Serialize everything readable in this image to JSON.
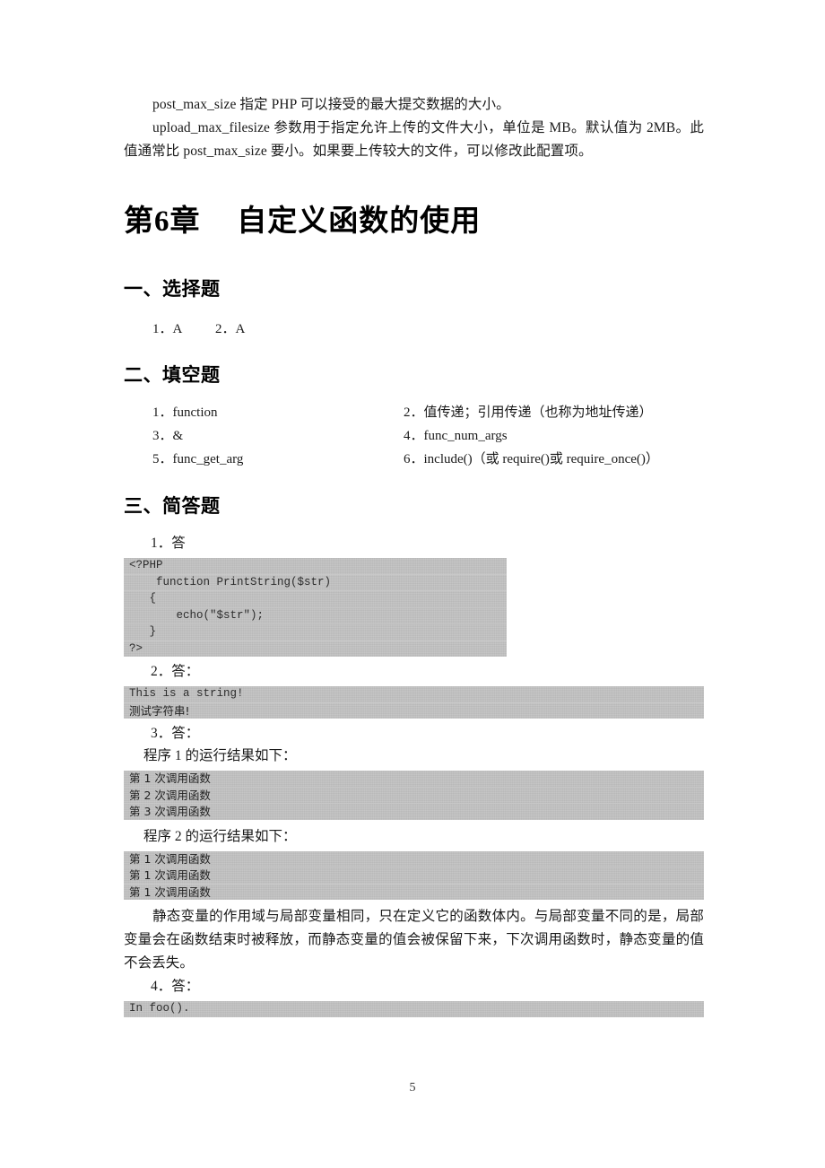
{
  "document": {
    "page_number": "5",
    "intro_paragraphs": [
      "post_max_size 指定 PHP 可以接受的最大提交数据的大小。",
      "upload_max_filesize 参数用于指定允许上传的文件大小，单位是 MB。默认值为 2MB。此值通常比 post_max_size 要小。如果要上传较大的文件，可以修改此配置项。"
    ],
    "chapter": {
      "prefix": "第",
      "number": "6",
      "suffix": "章",
      "title": "自定义函数的使用"
    },
    "sections": [
      {
        "heading": "一、选择题",
        "answers_inline": "1．A          2．A"
      },
      {
        "heading": "二、填空题",
        "fill_in_rows": [
          {
            "left": "1．function",
            "right": "2．值传递；引用传递（也称为地址传递）"
          },
          {
            "left": "3．&",
            "right": "4．func_num_args"
          },
          {
            "left": "5．func_get_arg",
            "right": "6．include()（或 require()或 require_once()）"
          }
        ]
      },
      {
        "heading": "三、简答题",
        "items": [
          {
            "label": "1．答",
            "code": {
              "width_class": "cb-w565",
              "lines": [
                {
                  "text": "<?PHP",
                  "cjk": false
                },
                {
                  "text": "    function PrintString($str)",
                  "cjk": false
                },
                {
                  "text": "   {",
                  "cjk": false
                },
                {
                  "text": "       echo(\"$str\");",
                  "cjk": false
                },
                {
                  "text": "   }",
                  "cjk": false
                },
                {
                  "text": "?>",
                  "cjk": false
                }
              ]
            }
          },
          {
            "label": "2．答：",
            "code": {
              "width_class": "cb-w785",
              "lines": [
                {
                  "text": "This is a string!",
                  "cjk": false
                },
                {
                  "text": "测试字符串!",
                  "cjk": true
                }
              ]
            }
          },
          {
            "label": "3．答：",
            "intro_1": "程序 1 的运行结果如下：",
            "code_1": {
              "width_class": "cb-w785",
              "lines": [
                {
                  "text": "第 1 次调用函数",
                  "cjk": true
                },
                {
                  "text": "第 2 次调用函数",
                  "cjk": true
                },
                {
                  "text": "第 3 次调用函数",
                  "cjk": true
                }
              ]
            },
            "intro_2": "程序 2 的运行结果如下：",
            "code_2": {
              "width_class": "cb-w785",
              "lines": [
                {
                  "text": "第 1 次调用函数",
                  "cjk": true
                },
                {
                  "text": "第 1 次调用函数",
                  "cjk": true
                },
                {
                  "text": "第 1 次调用函数",
                  "cjk": true
                }
              ]
            },
            "explanation": "静态变量的作用域与局部变量相同，只在定义它的函数体内。与局部变量不同的是，局部变量会在函数结束时被释放，而静态变量的值会被保留下来，下次调用函数时，静态变量的值不会丢失。"
          },
          {
            "label": "4．答：",
            "code": {
              "width_class": "cb-w785",
              "lines": [
                {
                  "text": "In foo().",
                  "cjk": false
                }
              ]
            }
          }
        ]
      }
    ]
  }
}
